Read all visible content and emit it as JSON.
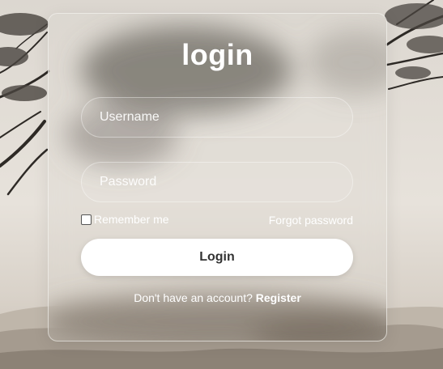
{
  "login_card": {
    "title": "login",
    "username_placeholder": "Username",
    "password_placeholder": "Password",
    "remember_label": "Remember me",
    "remember_checked": false,
    "forgot_label": "Forgot password",
    "login_button_label": "Login",
    "register_prompt": "Don't have an account?",
    "register_link": "Register"
  },
  "colors": {
    "text": "#ffffff",
    "button_bg": "#ffffff",
    "button_text": "#333333"
  }
}
